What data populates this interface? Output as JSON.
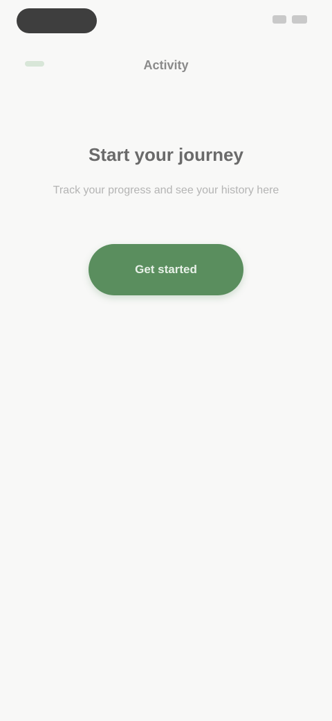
{
  "status_bar": {
    "icons": [
      "signal-icon",
      "battery-icon"
    ]
  },
  "header": {
    "title": "Activity"
  },
  "empty_state": {
    "title": "Start your journey",
    "description": "Track your progress and see your history here",
    "cta_label": "Get started"
  },
  "colors": {
    "background": "#f8f8f7",
    "accent": "#5a8e5e",
    "status_pill": "#3e3e3e"
  }
}
